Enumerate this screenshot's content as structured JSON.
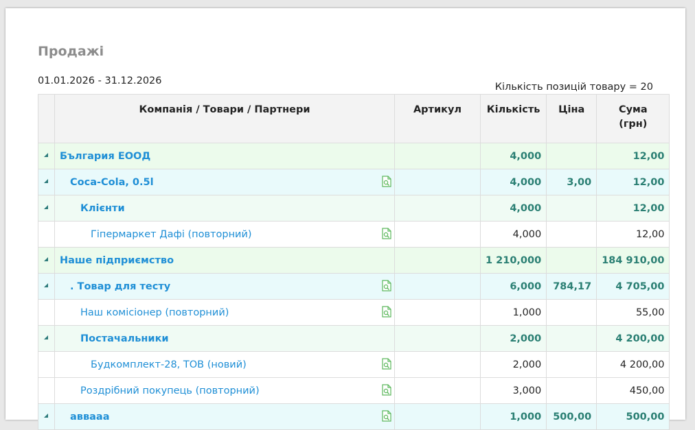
{
  "report": {
    "title": "Продажі",
    "period": "01.01.2026 - 31.12.2026",
    "count_note": "Кількість позицій товару = 20"
  },
  "table": {
    "headers": {
      "name": "Компанія / Товари / Партнери",
      "article": "Артикул",
      "qty": "Кількість",
      "price": "Ціна",
      "sum_line1": "Сума",
      "sum_line2": "(грн)"
    },
    "rows": [
      {
        "name": "България ЕООД",
        "article": "",
        "qty": "4,000",
        "price": "",
        "sum": "12,00",
        "level": 0,
        "toggle": true,
        "icon": false
      },
      {
        "name": "Coca-Cola, 0.5l",
        "article": "",
        "qty": "4,000",
        "price": "3,00",
        "sum": "12,00",
        "level": 1,
        "toggle": true,
        "icon": true
      },
      {
        "name": "Клієнти",
        "article": "",
        "qty": "4,000",
        "price": "",
        "sum": "12,00",
        "level": 2,
        "toggle": true,
        "icon": false
      },
      {
        "name": "Гіпермаркет Дафі (повторний)",
        "article": "",
        "qty": "4,000",
        "price": "",
        "sum": "12,00",
        "level": 3,
        "toggle": false,
        "icon": true
      },
      {
        "name": "Наше підприємство",
        "article": "",
        "qty": "1 210,000",
        "price": "",
        "sum": "184 910,00",
        "level": 0,
        "toggle": true,
        "icon": false
      },
      {
        "name": ". Товар для тесту",
        "article": "",
        "qty": "6,000",
        "price": "784,17",
        "sum": "4 705,00",
        "level": 1,
        "toggle": true,
        "icon": true
      },
      {
        "name": "Наш комісіонер (повторний)",
        "article": "",
        "qty": "1,000",
        "price": "",
        "sum": "55,00",
        "level": 4,
        "toggle": false,
        "icon": true
      },
      {
        "name": "Постачальники",
        "article": "",
        "qty": "2,000",
        "price": "",
        "sum": "4 200,00",
        "level": 2,
        "toggle": true,
        "icon": false
      },
      {
        "name": "Будкомплект-28, ТОВ (новий)",
        "article": "",
        "qty": "2,000",
        "price": "",
        "sum": "4 200,00",
        "level": 3,
        "toggle": false,
        "icon": true
      },
      {
        "name": "Роздрібний покупець (повторний)",
        "article": "",
        "qty": "3,000",
        "price": "",
        "sum": "450,00",
        "level": 4,
        "toggle": false,
        "icon": true
      },
      {
        "name": "аввааа",
        "article": "",
        "qty": "1,000",
        "price": "500,00",
        "sum": "500,00",
        "level": 1,
        "toggle": true,
        "icon": true
      }
    ]
  },
  "icons": {
    "toggle": "collapse-triangle-icon",
    "doc": "document-search-icon"
  },
  "colors": {
    "link": "#1f8fd6",
    "total_text": "#2a7f73",
    "level0_bg": "#ecfbec",
    "level1_bg": "#e9fafb",
    "level2_bg": "#f0fbf4",
    "icon_green": "#5cb85c"
  }
}
